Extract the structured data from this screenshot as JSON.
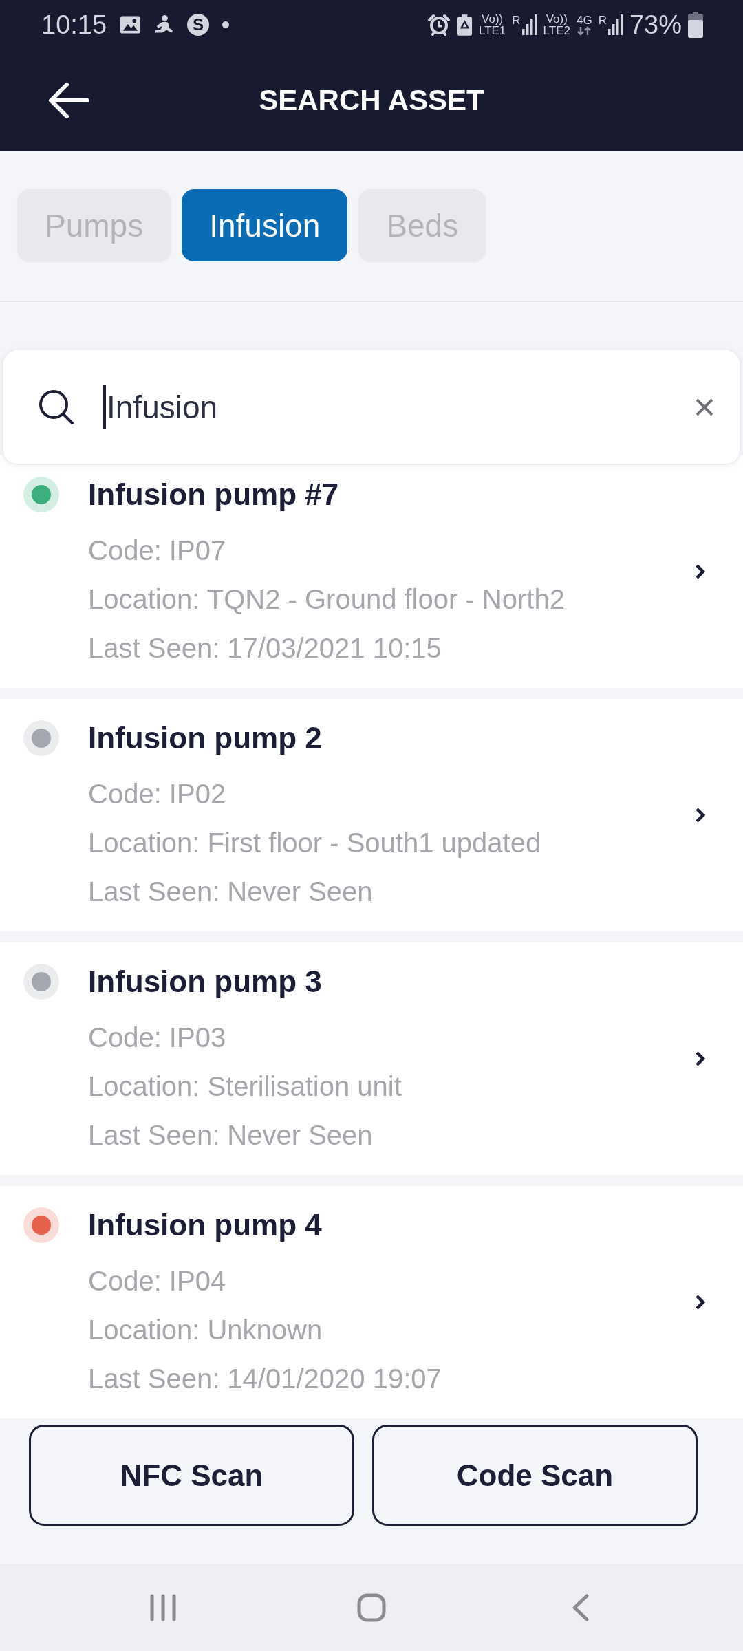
{
  "status_bar": {
    "time": "10:15",
    "app_badge": "S",
    "sims": [
      {
        "volte": "Vo))",
        "network": "LTE1",
        "roaming": "R"
      },
      {
        "volte": "Vo))",
        "network": "LTE2",
        "data": "4G",
        "roaming": "R"
      }
    ],
    "battery": "73%"
  },
  "header": {
    "title": "SEARCH ASSET"
  },
  "tabs": [
    {
      "label": "Pumps",
      "selected": false
    },
    {
      "label": "Infusion",
      "selected": true
    },
    {
      "label": "Beds",
      "selected": false
    }
  ],
  "search": {
    "value": "Infusion"
  },
  "assets": [
    {
      "name": "Infusion pump #7",
      "code": "Code: IP07",
      "location": "Location: TQN2 - Ground floor - North2",
      "last_seen": "Last Seen: 17/03/2021 10:15",
      "color": "#3bb07e"
    },
    {
      "name": "Infusion pump 2",
      "code": "Code: IP02",
      "location": "Location: First floor - South1 updated",
      "last_seen": "Last Seen: Never Seen",
      "color": "#a4a7b0"
    },
    {
      "name": "Infusion pump 3",
      "code": "Code: IP03",
      "location": "Location: Sterilisation unit",
      "last_seen": "Last Seen: Never Seen",
      "color": "#a4a7b0"
    },
    {
      "name": "Infusion pump 4",
      "code": "Code: IP04",
      "location": "Location: Unknown",
      "last_seen": "Last Seen: 14/01/2020 19:07",
      "color": "#e3604b"
    }
  ],
  "buttons": [
    "NFC Scan",
    "Code Scan"
  ]
}
